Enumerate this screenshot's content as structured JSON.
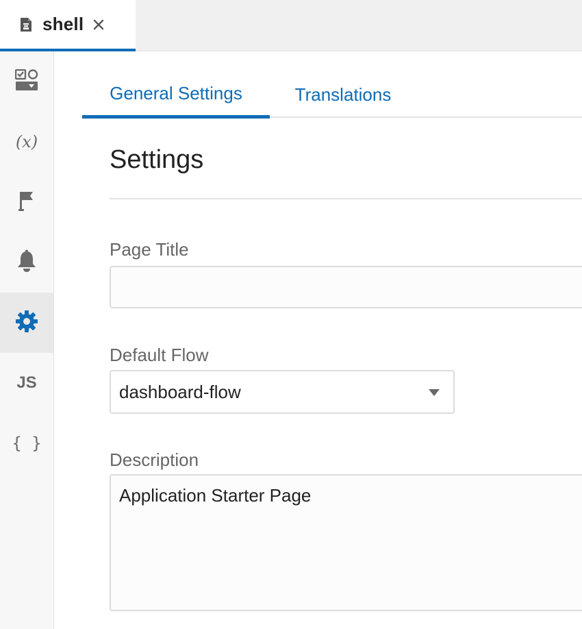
{
  "colors": {
    "accent": "#0f6cb6",
    "icon_gray": "#6b6b6b",
    "active_rail_bg": "#e9e9e9"
  },
  "file_tab": {
    "label": "shell",
    "icon": "file-icon",
    "close_icon": "close-icon"
  },
  "rail": {
    "items": [
      {
        "name": "components-icon",
        "active": false
      },
      {
        "name": "variables-icon",
        "text": "(x)",
        "active": false
      },
      {
        "name": "flag-icon",
        "active": false
      },
      {
        "name": "bell-icon",
        "active": false
      },
      {
        "name": "gear-icon",
        "active": true
      },
      {
        "name": "js-icon",
        "text": "JS",
        "active": false
      },
      {
        "name": "json-icon",
        "text": "{ }",
        "active": false
      }
    ]
  },
  "tabs": [
    {
      "label": "General Settings",
      "active": true
    },
    {
      "label": "Translations",
      "active": false
    }
  ],
  "settings": {
    "title": "Settings",
    "page_title": {
      "label": "Page Title",
      "value": "",
      "placeholder": ""
    },
    "default_flow": {
      "label": "Default Flow",
      "value": "dashboard-flow"
    },
    "description": {
      "label": "Description",
      "value": "Application Starter Page"
    }
  }
}
